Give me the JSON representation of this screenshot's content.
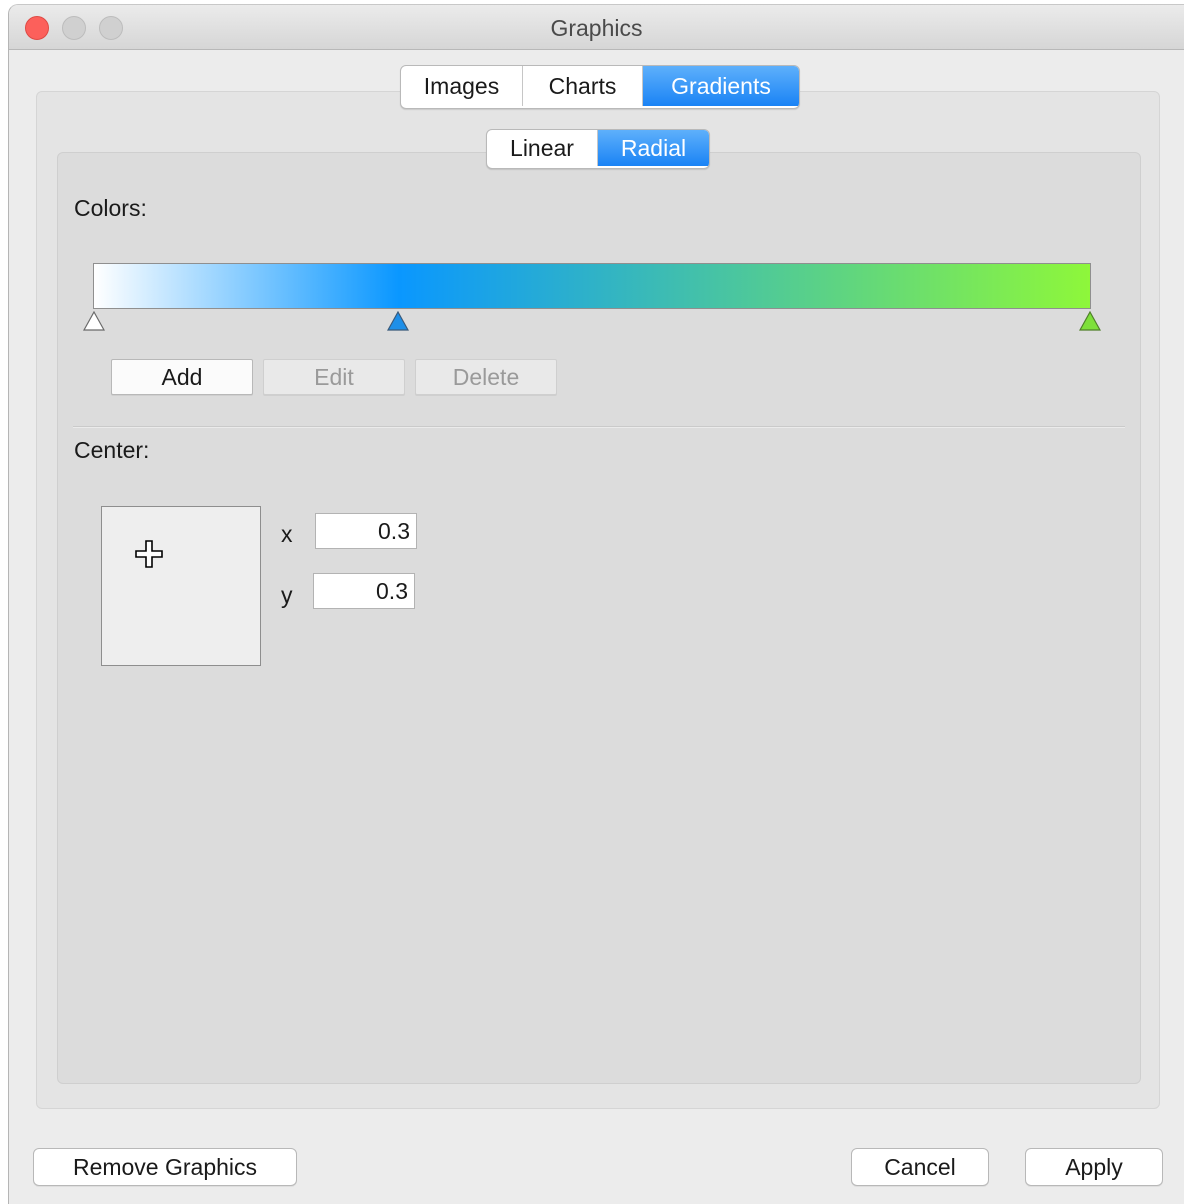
{
  "window": {
    "title": "Graphics"
  },
  "main_tabs": [
    {
      "label": "Images",
      "active": false
    },
    {
      "label": "Charts",
      "active": false
    },
    {
      "label": "Gradients",
      "active": true
    }
  ],
  "sub_tabs": [
    {
      "label": "Linear",
      "active": false
    },
    {
      "label": "Radial",
      "active": true
    }
  ],
  "colors_section": {
    "label": "Colors:",
    "stops": [
      {
        "position": 0.0,
        "color": "#ffffff"
      },
      {
        "position": 0.306,
        "color": "#0a97ff"
      },
      {
        "position": 1.0,
        "color": "#8ef73a"
      }
    ],
    "add_label": "Add",
    "edit_label": "Edit",
    "delete_label": "Delete"
  },
  "center_section": {
    "label": "Center:",
    "x_label": "x",
    "x_value": "0.3",
    "y_label": "y",
    "y_value": "0.3"
  },
  "footer": {
    "remove_label": "Remove Graphics",
    "cancel_label": "Cancel",
    "apply_label": "Apply"
  },
  "icons": [
    "crosshair-icon",
    "color-stop-marker"
  ],
  "colors": {
    "accent": "#1a83f5",
    "close": "#fc605b"
  }
}
